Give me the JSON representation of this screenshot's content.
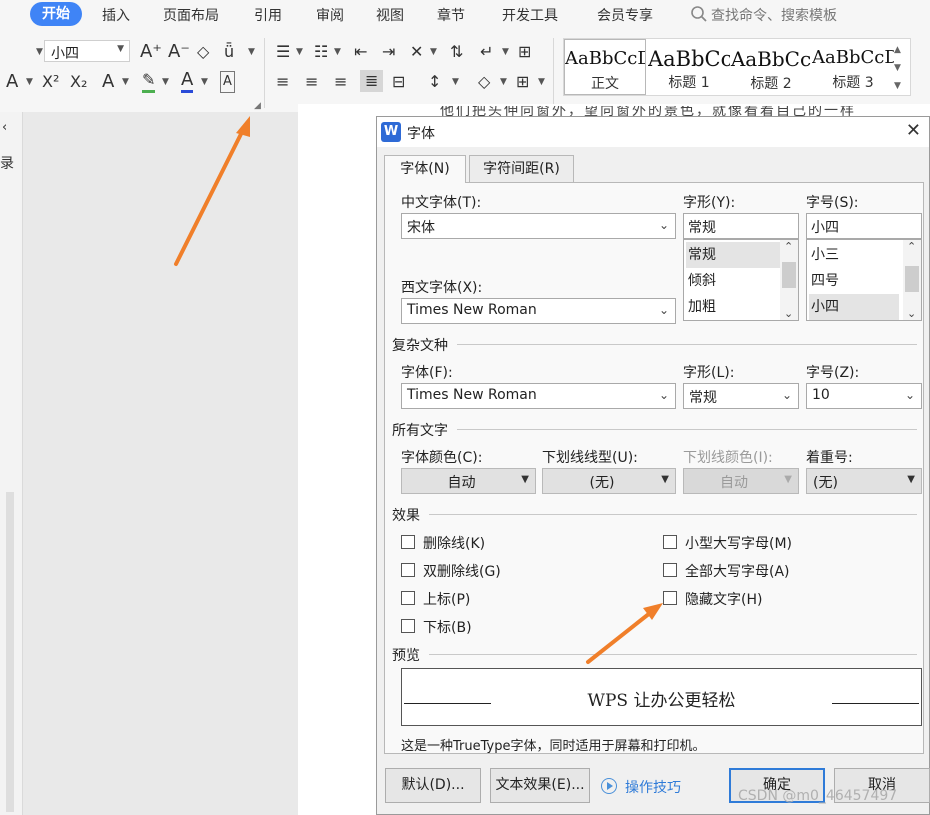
{
  "menubar": {
    "active_tab": "开始",
    "items": [
      "插入",
      "页面布局",
      "引用",
      "审阅",
      "视图",
      "章节",
      "开发工具",
      "会员专享"
    ],
    "search_label": "查找命令、搜索模板"
  },
  "ribbon": {
    "font_size_value": "小四",
    "styles": [
      {
        "sample": "AaBbCcDd",
        "label": "正文"
      },
      {
        "sample": "AaBbCc",
        "label": "标题 1"
      },
      {
        "sample": "AaBbCc",
        "label": "标题 2"
      },
      {
        "sample": "AaBbCcD",
        "label": "标题 3"
      }
    ]
  },
  "doc": {
    "left_pane_text": "录",
    "partial_text": "他们把头伸向窗外，望向窗外的景色，就像看着自己的一样"
  },
  "dialog": {
    "title": "字体",
    "tabs": [
      "字体(N)",
      "字符间距(R)"
    ],
    "cn_font_label": "中文字体(T):",
    "cn_font_value": "宋体",
    "style_label": "字形(Y):",
    "style_value": "常规",
    "style_options": [
      "常规",
      "倾斜",
      "加粗"
    ],
    "size_label": "字号(S):",
    "size_value": "小四",
    "size_options": [
      "小三",
      "四号",
      "小四"
    ],
    "west_font_label": "西文字体(X):",
    "west_font_value": "Times New Roman",
    "complex_group": "复杂文种",
    "complex_font_label": "字体(F):",
    "complex_font_value": "Times New Roman",
    "complex_style_label": "字形(L):",
    "complex_style_value": "常规",
    "complex_size_label": "字号(Z):",
    "complex_size_value": "10",
    "all_text_group": "所有文字",
    "color_label": "字体颜色(C):",
    "color_value": "自动",
    "underline_label": "下划线线型(U):",
    "underline_value": "(无)",
    "underline_color_label": "下划线颜色(I):",
    "underline_color_value": "自动",
    "emphasis_label": "着重号:",
    "emphasis_value": "(无)",
    "effects_group": "效果",
    "effects_left": [
      "删除线(K)",
      "双删除线(G)",
      "上标(P)",
      "下标(B)"
    ],
    "effects_right": [
      "小型大写字母(M)",
      "全部大写字母(A)",
      "隐藏文字(H)"
    ],
    "preview_group": "预览",
    "preview_text": "WPS 让办公更轻松",
    "description": "这是一种TrueType字体，同时适用于屏幕和打印机。",
    "btn_default": "默认(D)...",
    "btn_text_effect": "文本效果(E)...",
    "tips_link": "操作技巧",
    "btn_ok": "确定",
    "btn_cancel": "取消"
  },
  "watermark": "CSDN @m0_46457497",
  "colors": {
    "accent": "#3f84f6",
    "arrow": "#f07f2a",
    "link": "#2f7bd8"
  }
}
